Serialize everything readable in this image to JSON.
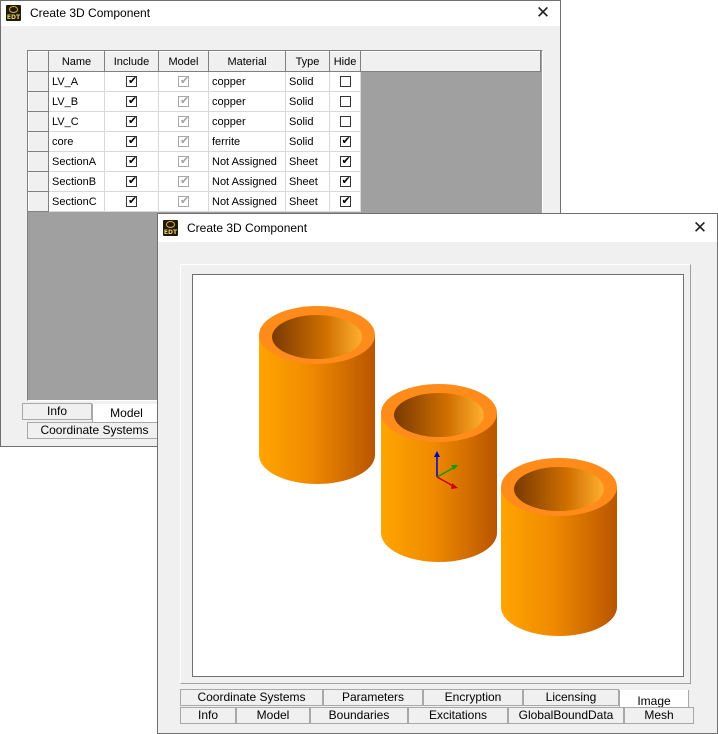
{
  "back_window": {
    "title": "Create 3D Component",
    "close_label": "✕",
    "columns": [
      "Name",
      "Include",
      "Model",
      "Material",
      "Type",
      "Hide"
    ],
    "rows": [
      {
        "name": "LV_A",
        "include": true,
        "model": true,
        "material": "copper",
        "type": "Solid",
        "hide": false
      },
      {
        "name": "LV_B",
        "include": true,
        "model": true,
        "material": "copper",
        "type": "Solid",
        "hide": false
      },
      {
        "name": "LV_C",
        "include": true,
        "model": true,
        "material": "copper",
        "type": "Solid",
        "hide": false
      },
      {
        "name": "core",
        "include": true,
        "model": true,
        "material": "ferrite",
        "type": "Solid",
        "hide": true
      },
      {
        "name": "SectionA",
        "include": true,
        "model": true,
        "material": "Not Assigned",
        "type": "Sheet",
        "hide": true
      },
      {
        "name": "SectionB",
        "include": true,
        "model": true,
        "material": "Not Assigned",
        "type": "Sheet",
        "hide": true
      },
      {
        "name": "SectionC",
        "include": true,
        "model": true,
        "material": "Not Assigned",
        "type": "Sheet",
        "hide": true
      }
    ],
    "tabs": {
      "info": "Info",
      "model": "Model",
      "coordinate_systems": "Coordinate Systems"
    }
  },
  "front_window": {
    "title": "Create 3D Component",
    "close_label": "✕",
    "tabs_row1": [
      "Coordinate Systems",
      "Parameters",
      "Encryption",
      "Licensing",
      "Image"
    ],
    "tabs_row2": [
      "Info",
      "Model",
      "Boundaries",
      "Excitations",
      "GlobalBoundData",
      "Mesh"
    ],
    "active_tab": "Image",
    "app_icon_text": "EDT"
  },
  "colors": {
    "cylinder_light": "#ffa500",
    "cylinder_dark": "#c06000",
    "rim": "#ff8c1a",
    "axis_x": "#cc0000",
    "axis_y": "#00a000",
    "axis_z": "#0000cc"
  }
}
